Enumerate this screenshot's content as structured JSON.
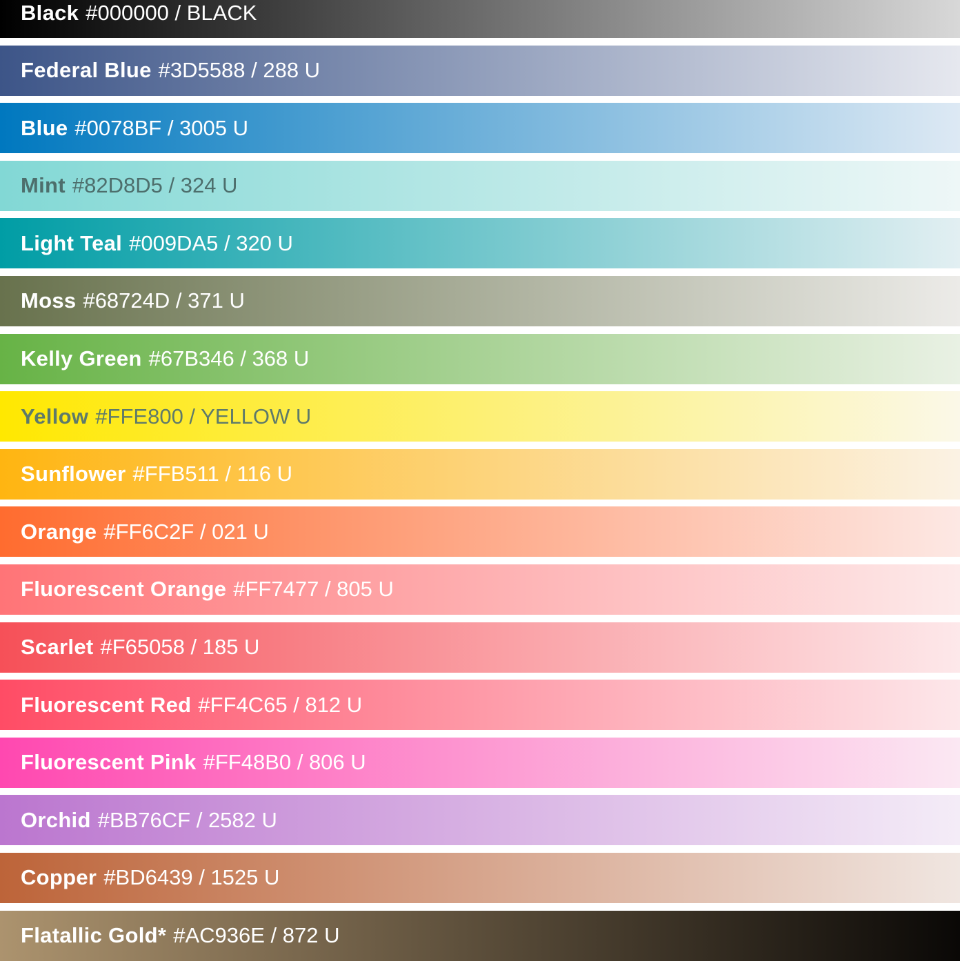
{
  "swatches": [
    {
      "name": "Black",
      "details": "#000000 / BLACK",
      "from": "#000000",
      "to": "#d8d8d8",
      "text_color": "#ffffff"
    },
    {
      "name": "Federal Blue",
      "details": "#3D5588 / 288 U",
      "from": "#3d5588",
      "to": "#e6e8ef",
      "text_color": "#ffffff"
    },
    {
      "name": "Blue",
      "details": "#0078BF / 3005 U",
      "from": "#0078bf",
      "to": "#dde9f4",
      "text_color": "#ffffff"
    },
    {
      "name": "Mint",
      "details": "#82D8D5 / 324 U",
      "from": "#82d8d5",
      "to": "#eef7f7",
      "text_color": "#4d6e6c"
    },
    {
      "name": "Light Teal",
      "details": "#009DA5 / 320 U",
      "from": "#009da5",
      "to": "#e2eff2",
      "text_color": "#ffffff"
    },
    {
      "name": "Moss",
      "details": "#68724D / 371 U",
      "from": "#68724d",
      "to": "#ecebe8",
      "text_color": "#ffffff"
    },
    {
      "name": "Kelly Green",
      "details": "#67B346 / 368 U",
      "from": "#67b346",
      "to": "#e9f1e4",
      "text_color": "#ffffff"
    },
    {
      "name": "Yellow",
      "details": "#FFE800 / YELLOW U",
      "from": "#ffe800",
      "to": "#fbf8e8",
      "text_color": "#5e7a6a"
    },
    {
      "name": "Sunflower",
      "details": "#FFB511 / 116 U",
      "from": "#ffb511",
      "to": "#fbf2e4",
      "text_color": "#ffffff"
    },
    {
      "name": "Orange",
      "details": "#FF6C2F / 021 U",
      "from": "#ff6c2f",
      "to": "#fde8e4",
      "text_color": "#ffffff"
    },
    {
      "name": "Fluorescent Orange",
      "details": "#FF7477 / 805 U",
      "from": "#ff7477",
      "to": "#fdeaea",
      "text_color": "#ffffff"
    },
    {
      "name": "Scarlet",
      "details": "#F65058 / 185 U",
      "from": "#f65058",
      "to": "#fde8ea",
      "text_color": "#ffffff"
    },
    {
      "name": "Fluorescent Red",
      "details": "#FF4C65 / 812 U",
      "from": "#ff4c65",
      "to": "#fde7ea",
      "text_color": "#ffffff"
    },
    {
      "name": "Fluorescent Pink",
      "details": "#FF48B0 / 806 U",
      "from": "#ff48b0",
      "to": "#fbe8f3",
      "text_color": "#ffffff"
    },
    {
      "name": "Orchid",
      "details": "#BB76CF / 2582 U",
      "from": "#bb76cf",
      "to": "#f4ecf7",
      "text_color": "#ffffff"
    },
    {
      "name": "Copper",
      "details": "#BD6439 / 1525 U",
      "from": "#bd6439",
      "to": "#f0e6e1",
      "text_color": "#ffffff"
    },
    {
      "name": "Flatallic Gold*",
      "details": "#AC936E / 872 U",
      "from": "#ac936e",
      "to": "#0a0806",
      "text_color": "#ffffff"
    }
  ]
}
